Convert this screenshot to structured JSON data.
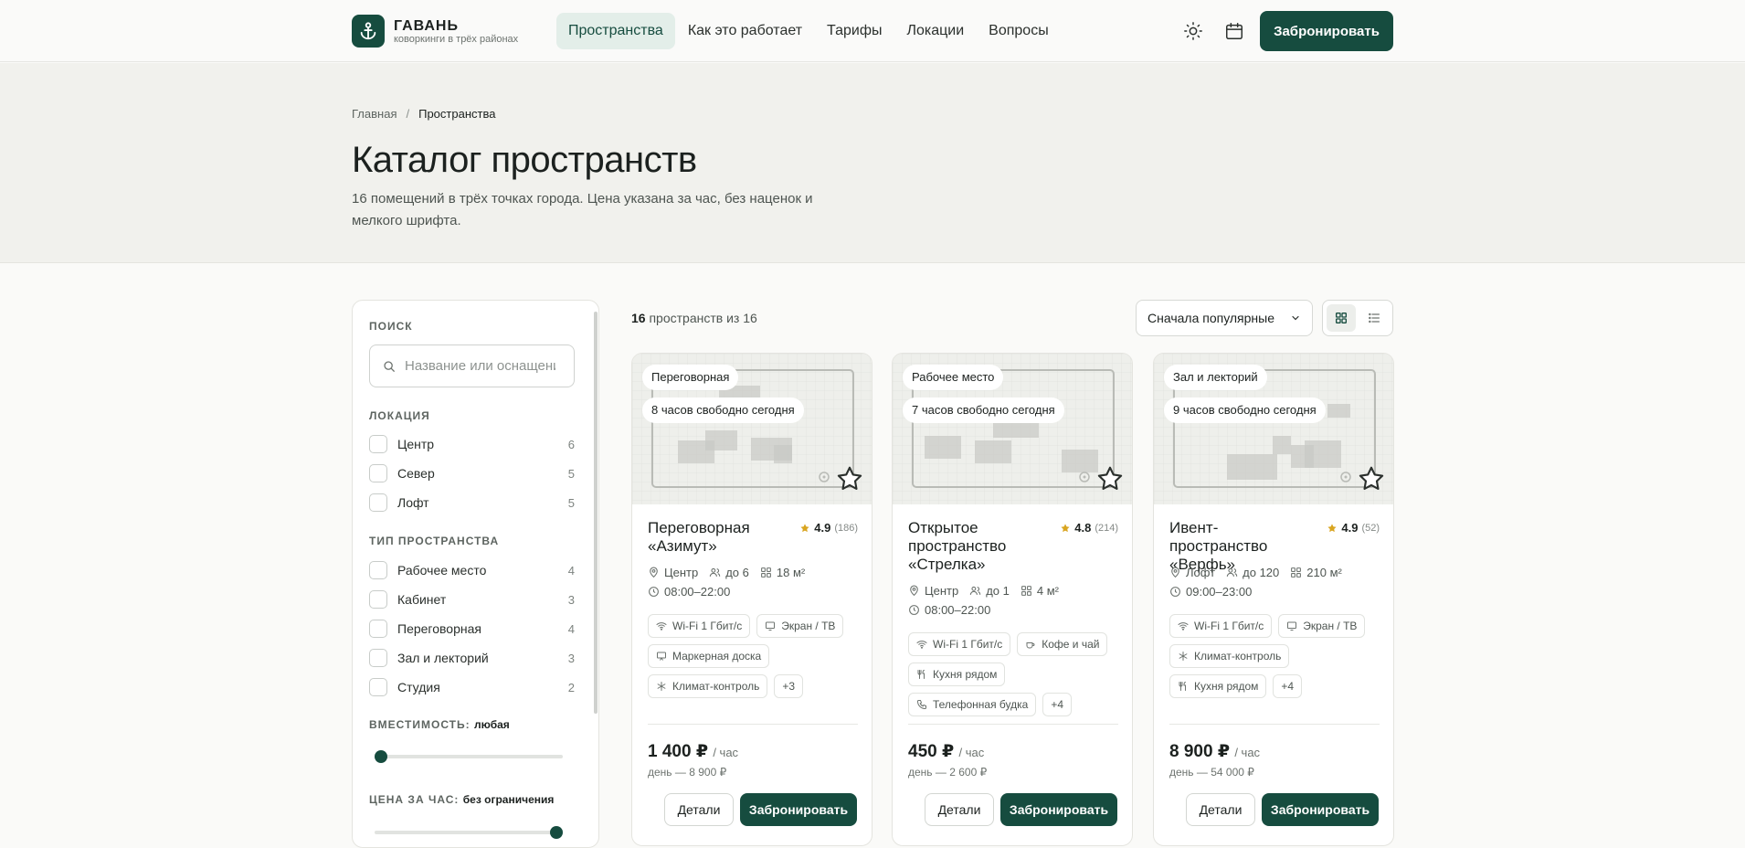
{
  "brand": {
    "title": "ГАВАНЬ",
    "subtitle": "коворкинги в трёх районах"
  },
  "nav": [
    {
      "label": "Пространства",
      "active": true
    },
    {
      "label": "Как это работает"
    },
    {
      "label": "Тарифы"
    },
    {
      "label": "Локации"
    },
    {
      "label": "Вопросы"
    }
  ],
  "header": {
    "book_label": "Забронировать",
    "icons": [
      "sun-icon",
      "calendar-icon"
    ]
  },
  "breadcrumb": {
    "home": "Главная",
    "separator": "/",
    "current": "Пространства"
  },
  "hero": {
    "title": "Каталог пространств",
    "description": "16 помещений в трёх точках города. Цена указана за час, без наценок и мелкого шрифта."
  },
  "filters": {
    "search_title": "ПОИСК",
    "search_placeholder": "Название или оснащение",
    "location_title": "ЛОКАЦИЯ",
    "locations": [
      {
        "label": "Центр",
        "count": "6"
      },
      {
        "label": "Север",
        "count": "5"
      },
      {
        "label": "Лофт",
        "count": "5"
      }
    ],
    "type_title": "ТИП ПРОСТРАНСТВА",
    "types": [
      {
        "label": "Рабочее место",
        "count": "4"
      },
      {
        "label": "Кабинет",
        "count": "3"
      },
      {
        "label": "Переговорная",
        "count": "4"
      },
      {
        "label": "Зал и лекторий",
        "count": "3"
      },
      {
        "label": "Студия",
        "count": "2"
      }
    ],
    "capacity_title": "ВМЕСТИМОСТЬ:",
    "capacity_value": "любая",
    "capacity_level": 0,
    "price_title": "ЦЕНА ЗА ЧАС:",
    "price_value": "без ограничения",
    "price_level": 1
  },
  "results": {
    "shown": "16",
    "text": "пространств из 16"
  },
  "sort": {
    "label": "Сначала популярные"
  },
  "view": {
    "active": "grid",
    "icons": [
      "grid-icon",
      "list-icon"
    ]
  },
  "cards": [
    {
      "type": "Переговорная",
      "availability": "8 часов свободно сегодня",
      "name": "Переговорная «Азимут»",
      "rating": "4.9",
      "reviews": "(186)",
      "location": "Центр",
      "capacity": "до 6",
      "area": "18 м²",
      "hours": "08:00–22:00",
      "amenities": [
        "Wi-Fi 1 Гбит/с",
        "Экран / ТВ",
        "Маркерная доска",
        "Климат-контроль"
      ],
      "amenity_icons": [
        "wifi-icon",
        "tv-icon",
        "board-icon",
        "snowflake-icon"
      ],
      "more": "+3",
      "price": "1 400 ₽",
      "per": "/ час",
      "day_price": "день — 8 900 ₽",
      "details_label": "Детали",
      "book_label": "Забронировать"
    },
    {
      "type": "Рабочее место",
      "availability": "7 часов свободно сегодня",
      "name": "Открытое пространство «Стрелка»",
      "rating": "4.8",
      "reviews": "(214)",
      "location": "Центр",
      "capacity": "до 1",
      "area": "4 м²",
      "hours": "08:00–22:00",
      "amenities": [
        "Wi-Fi 1 Гбит/с",
        "Кофе и чай",
        "Кухня рядом",
        "Телефонная будка"
      ],
      "amenity_icons": [
        "wifi-icon",
        "coffee-icon",
        "kitchen-icon",
        "phone-icon"
      ],
      "more": "+4",
      "price": "450 ₽",
      "per": "/ час",
      "day_price": "день — 2 600 ₽",
      "details_label": "Детали",
      "book_label": "Забронировать"
    },
    {
      "type": "Зал и лекторий",
      "availability": "9 часов свободно сегодня",
      "name": "Ивент-пространство «Верфь»",
      "rating": "4.9",
      "reviews": "(52)",
      "location": "Лофт",
      "capacity": "до 120",
      "area": "210 м²",
      "hours": "09:00–23:00",
      "amenities": [
        "Wi-Fi 1 Гбит/с",
        "Экран / ТВ",
        "Климат-контроль",
        "Кухня рядом"
      ],
      "amenity_icons": [
        "wifi-icon",
        "tv-icon",
        "snowflake-icon",
        "kitchen-icon"
      ],
      "more": "+4",
      "price": "8 900 ₽",
      "per": "/ час",
      "day_price": "день — 54 000 ₽",
      "details_label": "Детали",
      "book_label": "Забронировать"
    }
  ],
  "colors": {
    "accent": "#164c3f",
    "accent_light": "#e3eee9",
    "star": "#d9a520"
  }
}
